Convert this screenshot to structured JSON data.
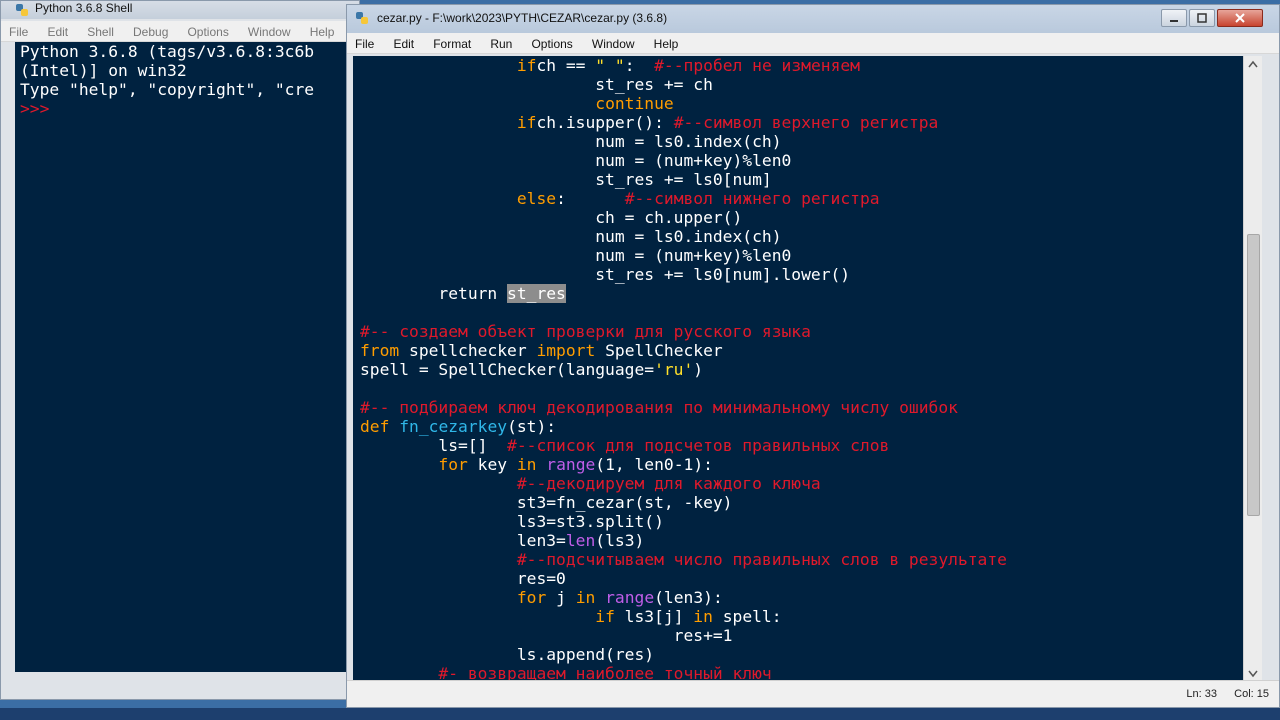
{
  "shell": {
    "title": "Python 3.6.8 Shell",
    "menus": [
      "File",
      "Edit",
      "Shell",
      "Debug",
      "Options",
      "Window",
      "Help"
    ],
    "lines": [
      "Python 3.6.8 (tags/v3.6.8:3c6b",
      "(Intel)] on win32",
      "Type \"help\", \"copyright\", \"cre"
    ],
    "prompt": ">>>"
  },
  "editor": {
    "title": "cezar.py - F:\\work\\2023\\PYTH\\CEZAR\\cezar.py (3.6.8)",
    "menus": [
      "File",
      "Edit",
      "Format",
      "Run",
      "Options",
      "Window",
      "Help"
    ],
    "status": {
      "line": "Ln: 33",
      "col": "Col: 15"
    },
    "code": [
      [
        [
          "",
          "                "
        ],
        [
          "kw",
          "if"
        ],
        [
          "",
          "ch == "
        ],
        [
          "str",
          "\" \""
        ],
        [
          "",
          ":  "
        ],
        [
          "com",
          "#--пробел не изменяем"
        ]
      ],
      [
        [
          "",
          "                        st_res += ch"
        ]
      ],
      [
        [
          "",
          "                        "
        ],
        [
          "kw",
          "continue"
        ]
      ],
      [
        [
          "",
          "                "
        ],
        [
          "kw",
          "if"
        ],
        [
          "",
          "ch.isupper(): "
        ],
        [
          "com",
          "#--символ верхнего регистра"
        ]
      ],
      [
        [
          "",
          "                        num = ls0.index(ch)"
        ]
      ],
      [
        [
          "",
          "                        num = (num+key)%len0"
        ]
      ],
      [
        [
          "",
          "                        st_res += ls0[num]"
        ]
      ],
      [
        [
          "",
          "                "
        ],
        [
          "kw",
          "else"
        ],
        [
          "",
          ":      "
        ],
        [
          "com",
          "#--символ нижнего регистра"
        ]
      ],
      [
        [
          "",
          "                        ch = ch.upper()"
        ]
      ],
      [
        [
          "",
          "                        num = ls0.index(ch)"
        ]
      ],
      [
        [
          "",
          "                        num = (num+key)%len0"
        ]
      ],
      [
        [
          "",
          "                        st_res += ls0[num].lower()"
        ]
      ],
      [
        [
          "",
          "        return "
        ],
        [
          "sel",
          "st_res"
        ]
      ],
      [
        [
          "",
          ""
        ]
      ],
      [
        [
          "com",
          "#-- создаем объект проверки для русского языка"
        ]
      ],
      [
        [
          "kw",
          "from"
        ],
        [
          "",
          " spellchecker "
        ],
        [
          "kw",
          "import"
        ],
        [
          "",
          " SpellChecker"
        ]
      ],
      [
        [
          "",
          "spell = SpellChecker(language="
        ],
        [
          "str",
          "'ru'"
        ],
        [
          "",
          ")"
        ]
      ],
      [
        [
          "",
          ""
        ]
      ],
      [
        [
          "com",
          "#-- подбираем ключ декодирования по минимальному числу ошибок"
        ]
      ],
      [
        [
          "kw",
          "def"
        ],
        [
          "",
          " "
        ],
        [
          "def",
          "fn_cezarkey"
        ],
        [
          "",
          "(st):"
        ]
      ],
      [
        [
          "",
          "        ls=[]  "
        ],
        [
          "com",
          "#--список для подсчетов правильных слов"
        ]
      ],
      [
        [
          "",
          "        "
        ],
        [
          "kw",
          "for"
        ],
        [
          "",
          " key "
        ],
        [
          "kw",
          "in"
        ],
        [
          "",
          " "
        ],
        [
          "bi",
          "range"
        ],
        [
          "",
          "(1, len0-1):"
        ]
      ],
      [
        [
          "",
          "                "
        ],
        [
          "com",
          "#--декодируем для каждого ключа"
        ]
      ],
      [
        [
          "",
          "                st3=fn_cezar(st, -key)"
        ]
      ],
      [
        [
          "",
          "                ls3=st3.split()"
        ]
      ],
      [
        [
          "",
          "                len3="
        ],
        [
          "bi",
          "len"
        ],
        [
          "",
          "(ls3)"
        ]
      ],
      [
        [
          "",
          "                "
        ],
        [
          "com",
          "#--подсчитываем число правильных слов в результате"
        ]
      ],
      [
        [
          "",
          "                res=0"
        ]
      ],
      [
        [
          "",
          "                "
        ],
        [
          "kw",
          "for"
        ],
        [
          "",
          " j "
        ],
        [
          "kw",
          "in"
        ],
        [
          "",
          " "
        ],
        [
          "bi",
          "range"
        ],
        [
          "",
          "(len3):"
        ]
      ],
      [
        [
          "",
          "                        "
        ],
        [
          "kw",
          "if"
        ],
        [
          "",
          " ls3[j] "
        ],
        [
          "kw",
          "in"
        ],
        [
          "",
          " spell:"
        ]
      ],
      [
        [
          "",
          "                                res+=1"
        ]
      ],
      [
        [
          "",
          "                ls.append(res)"
        ]
      ],
      [
        [
          "",
          "        "
        ],
        [
          "com",
          "#- возвращаем наиболее точный ключ"
        ]
      ]
    ]
  }
}
